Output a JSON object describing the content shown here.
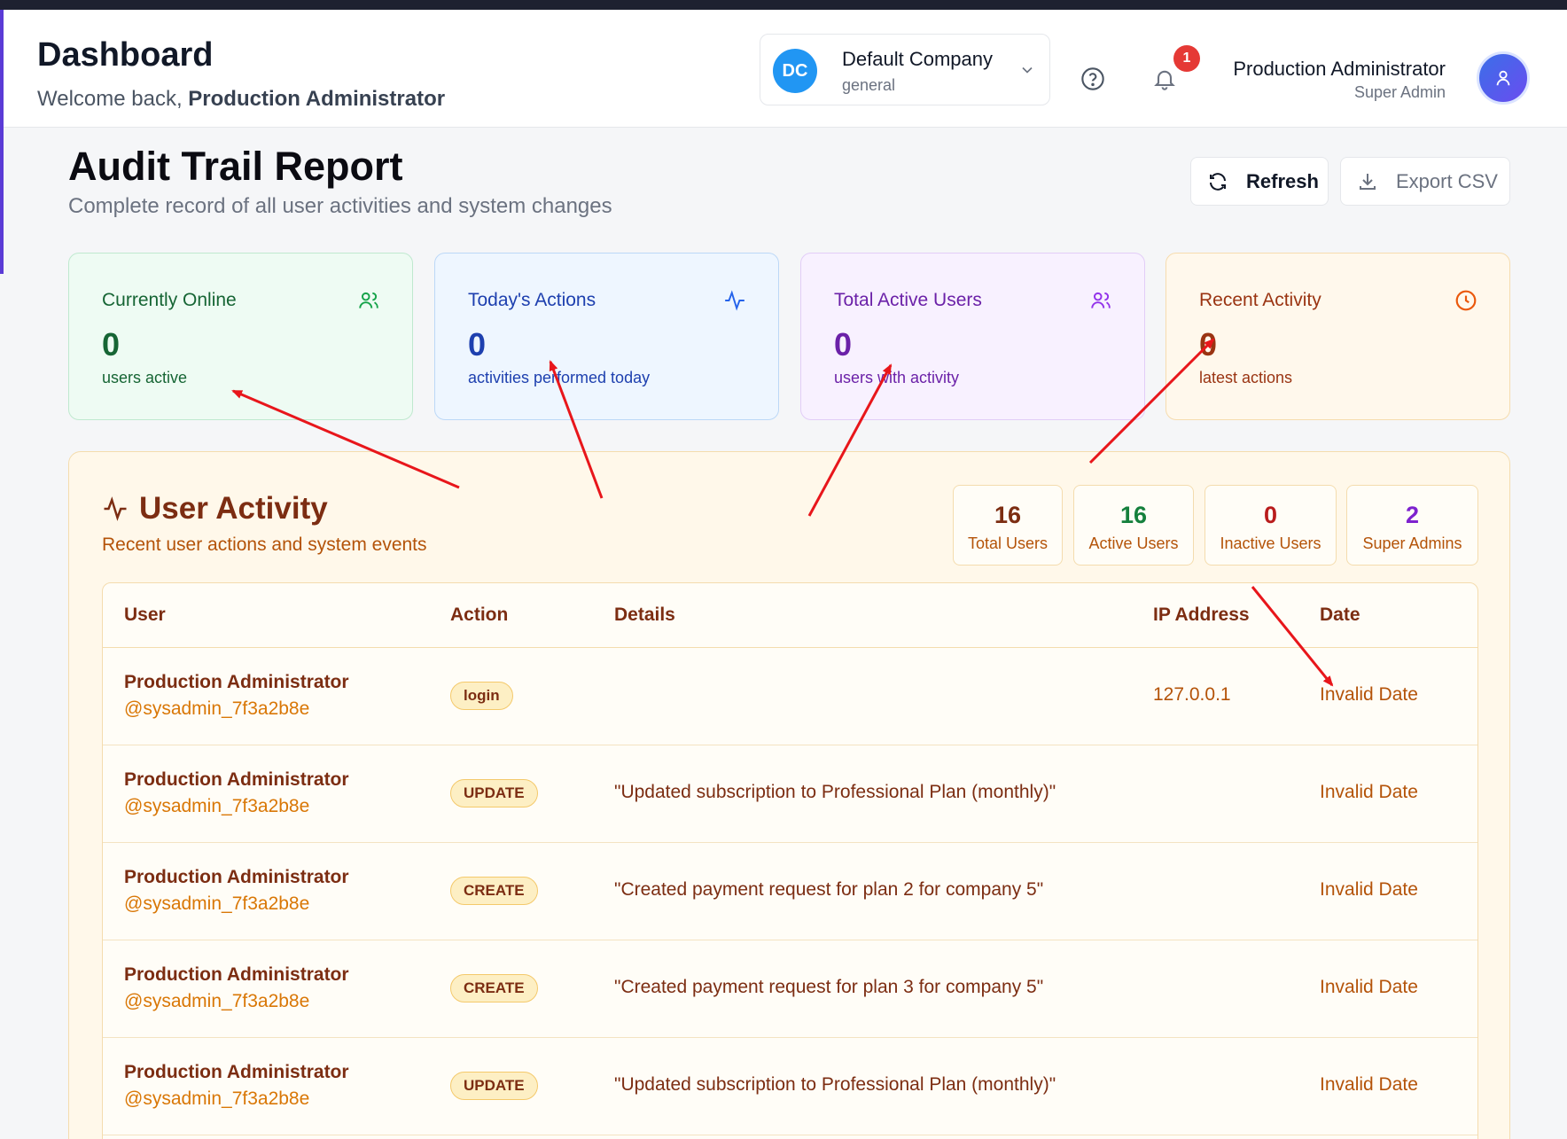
{
  "header": {
    "title": "Dashboard",
    "welcome_prefix": "Welcome back,",
    "welcome_name": "Production Administrator",
    "company": {
      "initials": "DC",
      "name": "Default Company",
      "type": "general"
    },
    "notification_count": "1",
    "user": {
      "name": "Production Administrator",
      "role": "Super Admin"
    }
  },
  "page": {
    "title": "Audit Trail Report",
    "subtitle": "Complete record of all user activities and system changes",
    "refresh_label": "Refresh",
    "export_label": "Export CSV"
  },
  "cards": [
    {
      "label": "Currently Online",
      "value": "0",
      "desc": "users active",
      "icon": "users-icon",
      "color": "#166534"
    },
    {
      "label": "Today's Actions",
      "value": "0",
      "desc": "activities performed today",
      "icon": "activity-icon",
      "color": "#1e40af"
    },
    {
      "label": "Total Active Users",
      "value": "0",
      "desc": "users with activity",
      "icon": "users-icon",
      "color": "#6b21a8"
    },
    {
      "label": "Recent Activity",
      "value": "0",
      "desc": "latest actions",
      "icon": "clock-icon",
      "color": "#9a3412"
    }
  ],
  "activity": {
    "title": "User Activity",
    "subtitle": "Recent user actions and system events",
    "stats": [
      {
        "value": "16",
        "label": "Total Users"
      },
      {
        "value": "16",
        "label": "Active Users"
      },
      {
        "value": "0",
        "label": "Inactive Users"
      },
      {
        "value": "2",
        "label": "Super Admins"
      }
    ],
    "columns": [
      "User",
      "Action",
      "Details",
      "IP Address",
      "Date"
    ],
    "rows": [
      {
        "name": "Production Administrator",
        "handle": "@sysadmin_7f3a2b8e",
        "action": "login",
        "details": "",
        "ip": "127.0.0.1",
        "date": "Invalid Date"
      },
      {
        "name": "Production Administrator",
        "handle": "@sysadmin_7f3a2b8e",
        "action": "UPDATE",
        "details": "\"Updated subscription to Professional Plan (monthly)\"",
        "ip": "",
        "date": "Invalid Date"
      },
      {
        "name": "Production Administrator",
        "handle": "@sysadmin_7f3a2b8e",
        "action": "CREATE",
        "details": "\"Created payment request for plan 2 for company 5\"",
        "ip": "",
        "date": "Invalid Date"
      },
      {
        "name": "Production Administrator",
        "handle": "@sysadmin_7f3a2b8e",
        "action": "CREATE",
        "details": "\"Created payment request for plan 3 for company 5\"",
        "ip": "",
        "date": "Invalid Date"
      },
      {
        "name": "Production Administrator",
        "handle": "@sysadmin_7f3a2b8e",
        "action": "UPDATE",
        "details": "\"Updated subscription to Professional Plan (monthly)\"",
        "ip": "",
        "date": "Invalid Date"
      }
    ]
  },
  "annotation_color": "#e8161b"
}
